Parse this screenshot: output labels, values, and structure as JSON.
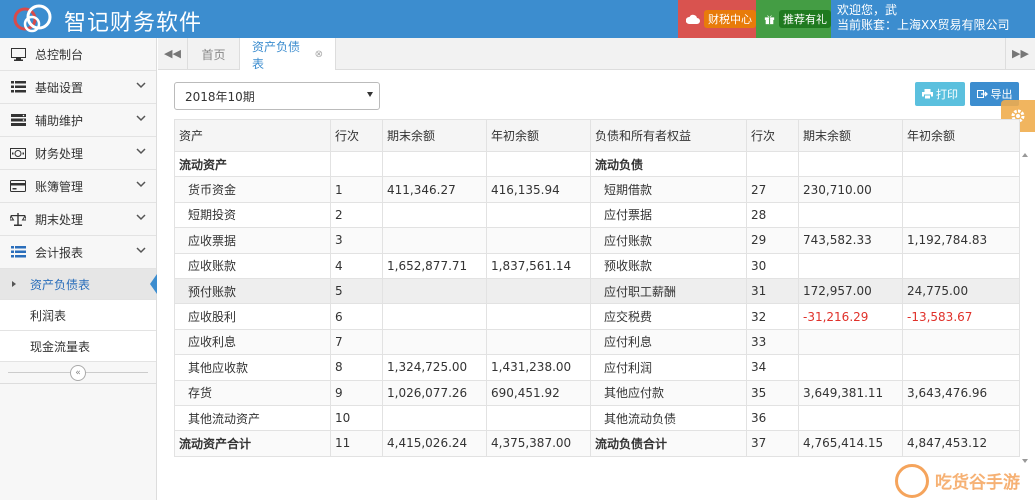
{
  "app": {
    "title": "智记财务软件",
    "logo_icon": "cloud-people-logo"
  },
  "header": {
    "tax_center": "财税中心",
    "gift": "推荐有礼",
    "welcome": "欢迎您，武",
    "account": "当前账套：上海XX贸易有限公司",
    "colors": {
      "bar": "#3c8dcf",
      "tax": "#d9534f",
      "gift": "#449d44"
    }
  },
  "sidebar": {
    "items": [
      {
        "label": "总控制台",
        "icon": "monitor-icon"
      },
      {
        "label": "基础设置",
        "icon": "list-icon"
      },
      {
        "label": "辅助维护",
        "icon": "server-icon"
      },
      {
        "label": "财务处理",
        "icon": "money-icon"
      },
      {
        "label": "账簿管理",
        "icon": "card-icon"
      },
      {
        "label": "期末处理",
        "icon": "scale-icon"
      },
      {
        "label": "会计报表",
        "icon": "list-icon"
      }
    ],
    "sub_items": [
      {
        "label": "资产负债表",
        "active": true
      },
      {
        "label": "利润表"
      },
      {
        "label": "现金流量表"
      }
    ]
  },
  "tabs": {
    "home": "首页",
    "current": "资产负债表"
  },
  "toolbar": {
    "period": "2018年10期",
    "print": "打印",
    "export": "导出"
  },
  "table": {
    "headers": [
      "资产",
      "行次",
      "期末余额",
      "年初余额",
      "负债和所有者权益",
      "行次",
      "期末余额",
      "年初余额"
    ],
    "rows": [
      [
        "流动资产",
        "",
        "",
        "",
        "流动负债",
        "",
        "",
        ""
      ],
      [
        "货币资金",
        "1",
        "411,346.27",
        "416,135.94",
        "短期借款",
        "27",
        "230,710.00",
        ""
      ],
      [
        "短期投资",
        "2",
        "",
        "",
        "应付票据",
        "28",
        "",
        ""
      ],
      [
        "应收票据",
        "3",
        "",
        "",
        "应付账款",
        "29",
        "743,582.33",
        "1,192,784.83"
      ],
      [
        "应收账款",
        "4",
        "1,652,877.71",
        "1,837,561.14",
        "预收账款",
        "30",
        "",
        ""
      ],
      [
        "预付账款",
        "5",
        "",
        "",
        "应付职工薪酬",
        "31",
        "172,957.00",
        "24,775.00"
      ],
      [
        "应收股利",
        "6",
        "",
        "",
        "应交税费",
        "32",
        "-31,216.29",
        "-13,583.67"
      ],
      [
        "应收利息",
        "7",
        "",
        "",
        "应付利息",
        "33",
        "",
        ""
      ],
      [
        "其他应收款",
        "8",
        "1,324,725.00",
        "1,431,238.00",
        "应付利润",
        "34",
        "",
        ""
      ],
      [
        "存货",
        "9",
        "1,026,077.26",
        "690,451.92",
        "其他应付款",
        "35",
        "3,649,381.11",
        "3,643,476.96"
      ],
      [
        "其他流动资产",
        "10",
        "",
        "",
        "其他流动负债",
        "36",
        "",
        ""
      ],
      [
        "流动资产合计",
        "11",
        "4,415,026.24",
        "4,375,387.00",
        "流动负债合计",
        "37",
        "4,765,414.15",
        "4,847,453.12"
      ]
    ]
  },
  "watermark": "吃货谷手游"
}
